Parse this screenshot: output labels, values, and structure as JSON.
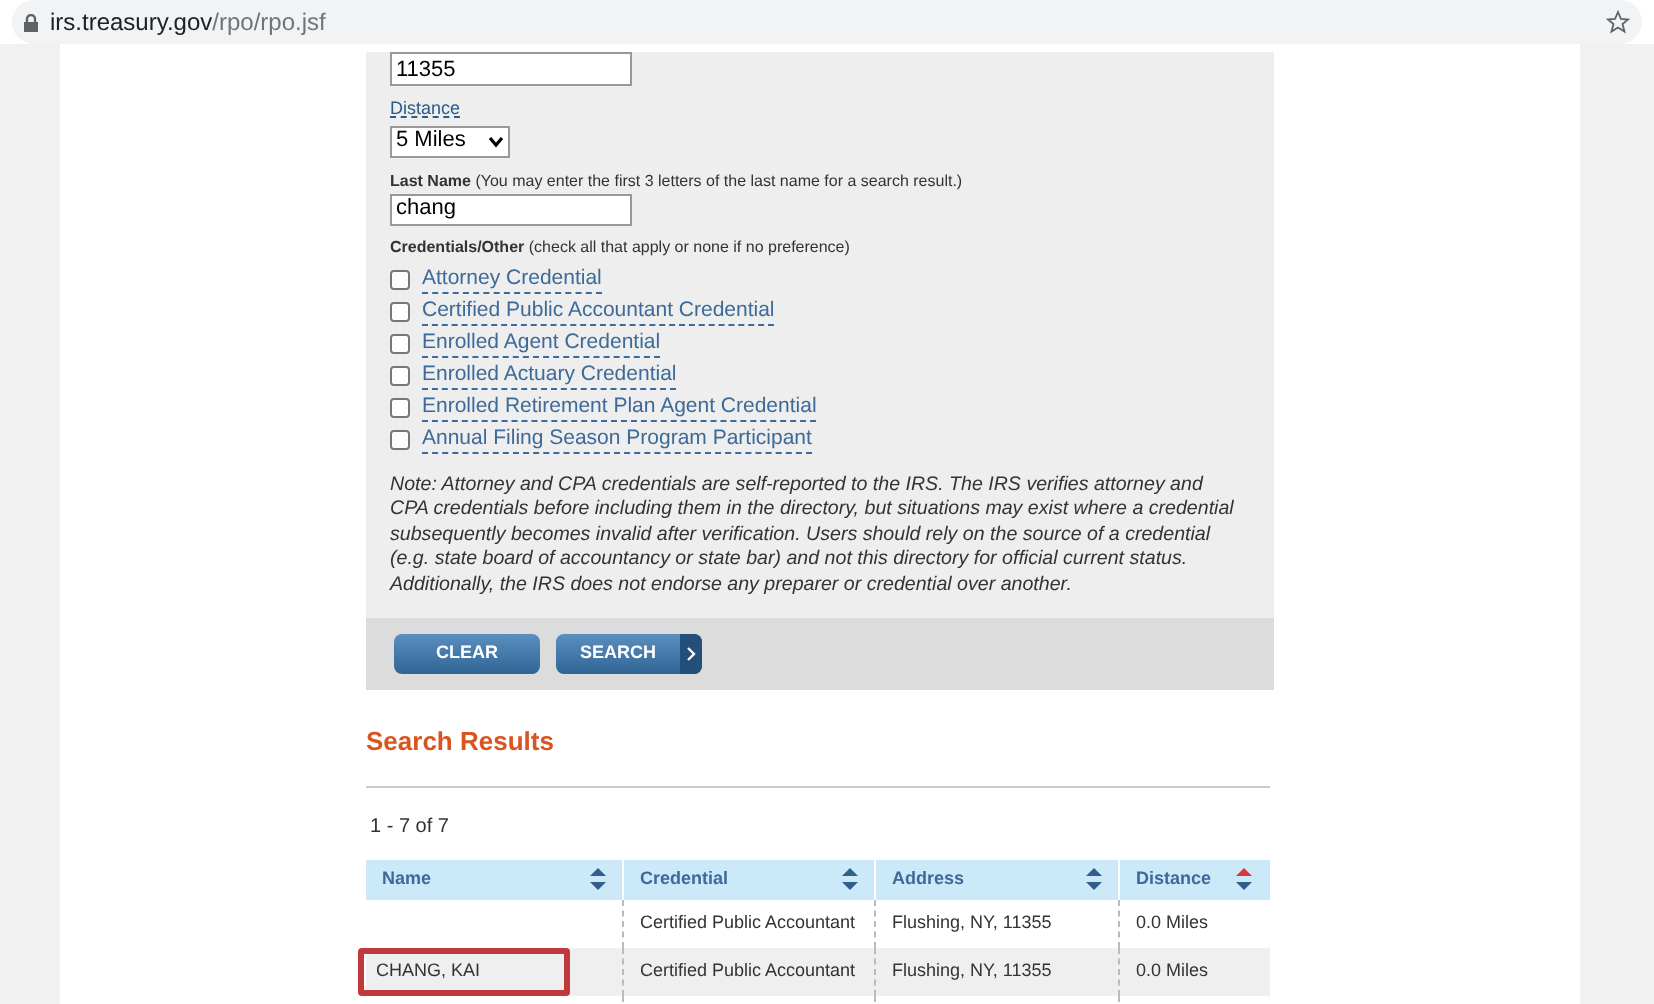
{
  "address_bar": {
    "host": "irs.treasury.gov",
    "path": "/rpo/rpo.jsf"
  },
  "form": {
    "zip": {
      "value": "11355"
    },
    "distance": {
      "label": "Distance",
      "value": "5 Miles"
    },
    "last_name": {
      "label": "Last Name",
      "hint": "(You may enter the first 3 letters of the last name for a search result.)",
      "value": "chang"
    },
    "credentials": {
      "label": "Credentials/Other",
      "hint": "(check all that apply or none if no preference)",
      "options": [
        {
          "label": "Attorney Credential",
          "checked": false
        },
        {
          "label": "Certified Public Accountant Credential",
          "checked": false
        },
        {
          "label": "Enrolled Agent Credential",
          "checked": false
        },
        {
          "label": "Enrolled Actuary Credential",
          "checked": false
        },
        {
          "label": "Enrolled Retirement Plan Agent Credential",
          "checked": false
        },
        {
          "label": "Annual Filing Season Program Participant",
          "checked": false
        }
      ]
    },
    "note": "Note: Attorney and CPA credentials are self-reported to the IRS. The IRS verifies attorney and CPA credentials before including them in the directory, but situations may exist where a credential subsequently becomes invalid after verification. Users should rely on the source of a credential (e.g. state board of accountancy or state bar) and not this directory for official current status. Additionally, the IRS does not endorse any preparer or credential over another.",
    "buttons": [
      {
        "label": "CLEAR",
        "kind": "plain"
      },
      {
        "label": "SEARCH",
        "kind": "arrow"
      }
    ]
  },
  "results": {
    "title": "Search Results",
    "count": "1 - 7 of 7",
    "columns": [
      {
        "label": "Name",
        "sorted": false
      },
      {
        "label": "Credential",
        "sorted": false
      },
      {
        "label": "Address",
        "sorted": false
      },
      {
        "label": "Distance",
        "sorted": true
      }
    ],
    "rows": [
      {
        "credential": "Certified Public Accountant",
        "address": "Flushing, NY, 11355",
        "distance": "0.0 Miles",
        "highlighted": false
      },
      {
        "name": "CHANG, KAI",
        "credential": "Certified Public Accountant",
        "address": "Flushing, NY, 11355",
        "distance": "0.0 Miles",
        "highlighted": true
      }
    ]
  }
}
